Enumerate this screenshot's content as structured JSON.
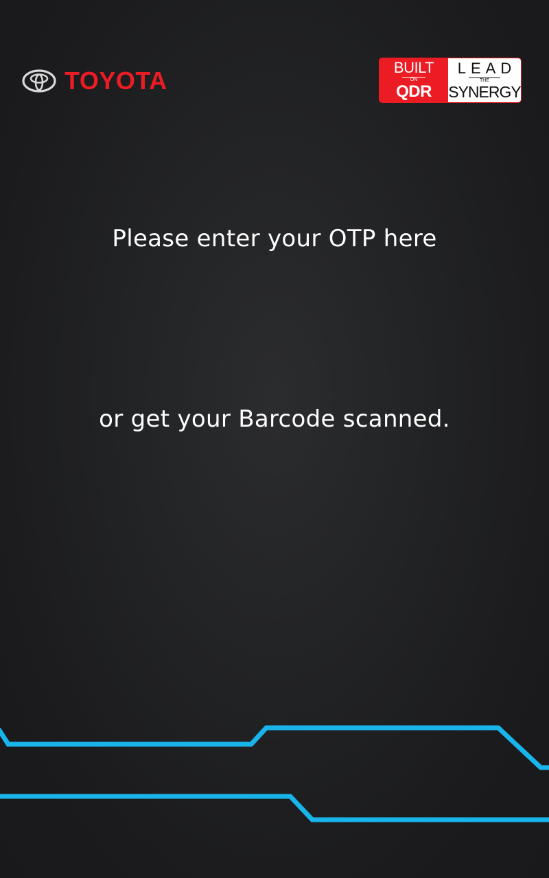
{
  "header": {
    "brand_name": "TOYOTA",
    "badge": {
      "left_top": "BUILT",
      "left_middle": "ON",
      "left_bottom": "QDR",
      "right_top": "LEAD",
      "right_middle": "THE",
      "right_bottom": "SYNERGY"
    }
  },
  "main": {
    "otp_prompt": "Please enter your OTP here",
    "barcode_prompt": "or get your Barcode scanned."
  },
  "colors": {
    "brand_red": "#eb1c24",
    "accent_cyan": "#18b4ea",
    "background": "#1e1f21",
    "text": "#ffffff"
  },
  "icons": {
    "brand_emblem": "toyota-emblem-icon"
  }
}
